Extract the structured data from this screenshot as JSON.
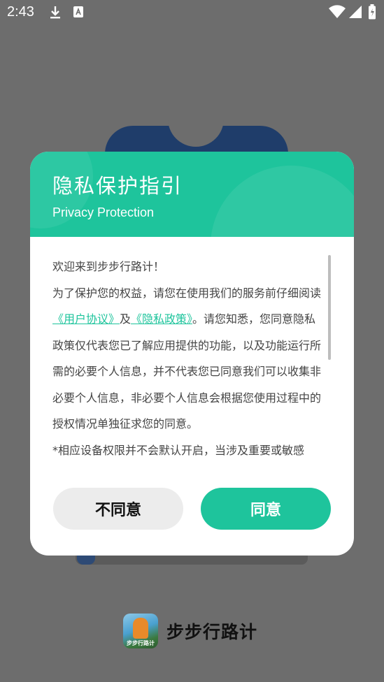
{
  "status_bar": {
    "time": "2:43"
  },
  "app": {
    "name": "步步行路计",
    "logo_text": "步步行路计"
  },
  "dialog": {
    "title": "隐私保护指引",
    "subtitle": "Privacy Protection",
    "body": {
      "line1": "欢迎来到步步行路计！",
      "p2_pre": "为了保护您的权益，请您在使用我们的服务前仔细阅读",
      "link_user": "《用户协议》",
      "and": "及",
      "link_privacy": "《隐私政策》",
      "p2_post": "。请您知悉，您同意隐私政策仅代表您已了解应用提供的功能，以及功能运行所需的必要个人信息，并不代表您已同意我们可以收集非必要个人信息，非必要个人信息会根据您使用过程中的授权情况单独征求您的同意。",
      "p3": "*相应设备权限并不会默认开启，当涉及重要或敏感"
    },
    "decline_label": "不同意",
    "agree_label": "同意"
  }
}
